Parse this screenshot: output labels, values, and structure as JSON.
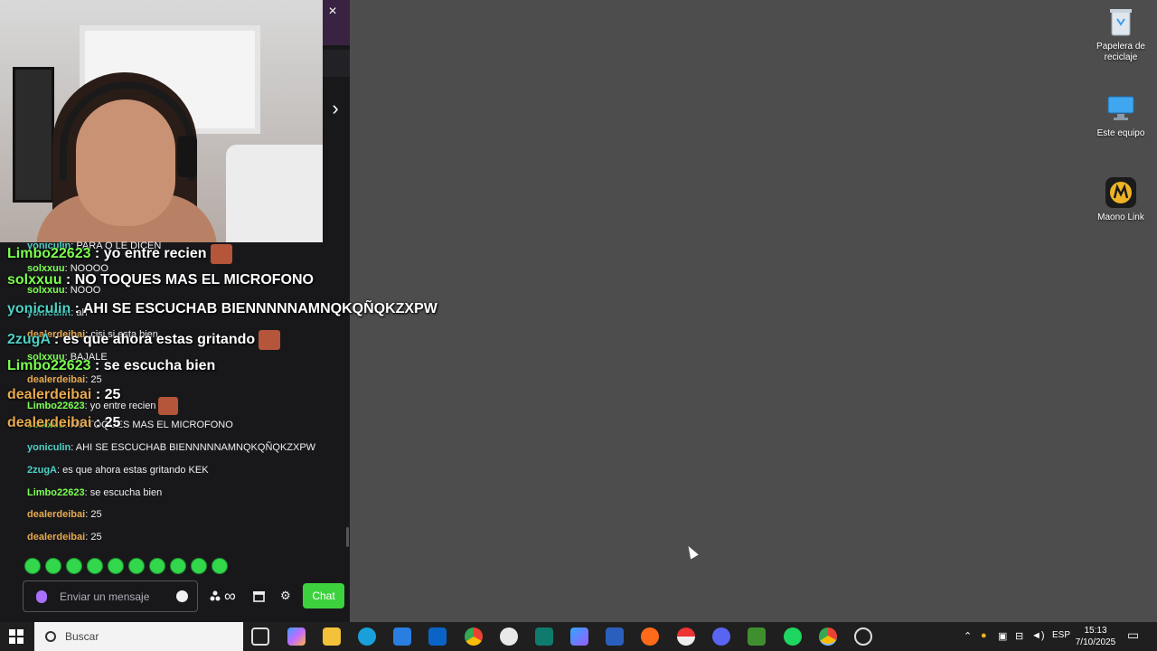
{
  "desktop": {
    "icons": [
      {
        "label_line1": "Papelera de",
        "label_line2": "reciclaje",
        "icon": "recycle-bin-icon"
      },
      {
        "label_line1": "Este equipo",
        "label_line2": "",
        "icon": "computer-icon"
      },
      {
        "label_line1": "Maono Link",
        "label_line2": "",
        "icon": "maono-link-icon"
      }
    ]
  },
  "chat": {
    "close_glyph": "×",
    "collapse_glyph": "›",
    "messages": [
      {
        "user": "yoniculin",
        "text": "PARA Q LE DICEN",
        "color": "#4fd1c5"
      },
      {
        "user": "solxxuu",
        "text": "NOOOO",
        "color": "#7cff4f"
      },
      {
        "user": "solxxuu",
        "text": "NOOO",
        "color": "#7cff4f"
      },
      {
        "user": "yoniculin",
        "text": "ah",
        "color": "#4fd1c5"
      },
      {
        "user": "dealerdeibai",
        "text": "cisi si esta bien",
        "color": "#e8a94c"
      },
      {
        "user": "solxxuu",
        "text": "BAJALE",
        "color": "#7cff4f"
      },
      {
        "user": "dealerdeibai",
        "text": "25",
        "color": "#e8a94c"
      },
      {
        "user": "Limbo22623",
        "text": "yo entre recien",
        "color": "#7cff4f"
      },
      {
        "user": "solxxuu",
        "text": "NO TOQUES MAS EL MICROFONO",
        "color": "#7cff4f"
      },
      {
        "user": "yoniculin",
        "text": "AHI SE ESCUCHAB BIENNNNNAMNQKQÑQKZXPW",
        "color": "#4fd1c5"
      },
      {
        "user": "2zugA",
        "text": "es que ahora estas gritando KEK",
        "color": "#4fd1c5"
      },
      {
        "user": "Limbo22623",
        "text": "se escucha bien",
        "color": "#7cff4f"
      },
      {
        "user": "dealerdeibai",
        "text": "25",
        "color": "#e8a94c"
      },
      {
        "user": "dealerdeibai",
        "text": "25",
        "color": "#e8a94c"
      }
    ],
    "overlay": [
      {
        "user": "Limbo22623",
        "text": "yo entre recien",
        "color": "#7cff4f",
        "emote": true
      },
      {
        "user": "solxxuu",
        "text": "NO TOQUES MAS EL MICROFONO",
        "color": "#7cff4f",
        "emote": false
      },
      {
        "user": "yoniculin",
        "text": "AHI SE ESCUCHAB BIENNNNNAMNQKQÑQKZXPW",
        "color": "#4fd1c5",
        "emote": false
      },
      {
        "user": "2zugA",
        "text": "es que ahora estas gritando",
        "color": "#4fd1c5",
        "emote": true
      },
      {
        "user": "Limbo22623",
        "text": "se escucha bien",
        "color": "#7cff4f",
        "emote": false
      },
      {
        "user": "dealerdeibai",
        "text": "25",
        "color": "#e8a94c",
        "emote": false
      },
      {
        "user": "dealerdeibai",
        "text": "25",
        "color": "#e8a94c",
        "emote": false
      }
    ],
    "input_placeholder": "Enviar un mensaje",
    "chat_button": "Chat",
    "infinity_glyph": "∞",
    "settings_glyph": "⚙"
  },
  "taskbar": {
    "search_label": "Buscar",
    "language": "ESP",
    "time": "15:13",
    "date": "7/10/2025",
    "colors": {
      "accent": "#7fbfff",
      "twitch_green": "#3dd23d"
    }
  }
}
